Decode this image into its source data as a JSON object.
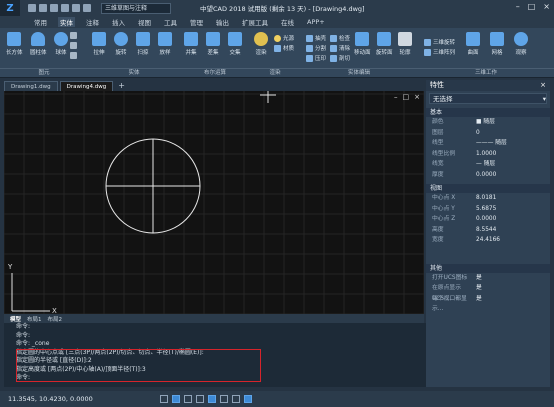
{
  "app": {
    "workspace": "三维草图与注释",
    "title": "中望CAD 2018 试用版 (剩余 13 天) - [Drawing4.dwg]"
  },
  "menu_tabs": [
    "常用",
    "实体",
    "注释",
    "插入",
    "视图",
    "工具",
    "管理",
    "输出",
    "扩展工具",
    "在线",
    "APP+"
  ],
  "menu_active": "实体",
  "ribbon": {
    "primitives": [
      "长方体",
      "圆柱体",
      "球体"
    ],
    "solid": [
      "拉伸",
      "旋转",
      "扫掠",
      "放样"
    ],
    "boolean": [
      "并集",
      "差集",
      "交集"
    ],
    "render": [
      "渲染"
    ],
    "light": "光源",
    "material": "材质",
    "edit_small": [
      "抽壳",
      "分割",
      "压印",
      "检查",
      "清除",
      "剖切"
    ],
    "edit_big": [
      "移动面",
      "旋转面",
      "轮廓"
    ],
    "view": [
      "曲面",
      "网格",
      "观察"
    ],
    "rotate3d": "三维旋转",
    "array3d": "三维阵列",
    "group_labels": [
      "图元",
      "实体",
      "布尔运算",
      "渲染",
      "实体编辑",
      "三维工作"
    ]
  },
  "doc_tabs": [
    "Drawing1.dwg",
    "Drawing4.dwg"
  ],
  "doc_tab_active": "Drawing4.dwg",
  "layout_tabs": [
    "模型",
    "布局1",
    "布局2"
  ],
  "command_lines": [
    "命令:",
    "命令:",
    "命令: _cone",
    "指定圆的中心点或 [三点(3P)/两点(2P)/切点、切点、半径(T)/椭圆(E)]:",
    "指定圆的半径或 [直径(D)]:2",
    "指定高度或 [两点(2P)/中心轴(A)/顶面半径(T)]:3",
    "命令:"
  ],
  "panel": {
    "title": "特性",
    "selection": "无选择",
    "basic_title": "基本",
    "basic": [
      {
        "k": "颜色",
        "v": "■ 随层"
      },
      {
        "k": "图层",
        "v": "0"
      },
      {
        "k": "线型",
        "v": "——— 随层"
      },
      {
        "k": "线型比例",
        "v": "1.0000"
      },
      {
        "k": "线宽",
        "v": "— 随层"
      },
      {
        "k": "厚度",
        "v": "0.0000"
      }
    ],
    "view_title": "视图",
    "view": [
      {
        "k": "中心点 X",
        "v": "8.0181"
      },
      {
        "k": "中心点 Y",
        "v": "5.6875"
      },
      {
        "k": "中心点 Z",
        "v": "0.0000"
      },
      {
        "k": "高度",
        "v": "8.5544"
      },
      {
        "k": "宽度",
        "v": "24.4166"
      }
    ],
    "other_title": "其他",
    "other": [
      {
        "k": "打开UCS图标",
        "v": "是"
      },
      {
        "k": "在原点显示 UCS...",
        "v": "是"
      },
      {
        "k": "每个视口都显示...",
        "v": "是"
      }
    ]
  },
  "status": {
    "coords": "11.3545, 10.4230, 0.0000"
  }
}
